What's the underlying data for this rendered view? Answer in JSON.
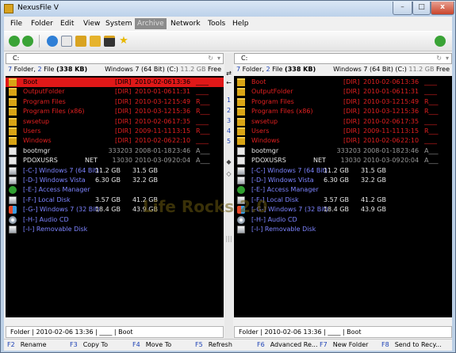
{
  "window": {
    "title": "NexusFile V",
    "minimize": "–",
    "maximize": "□",
    "close": "x"
  },
  "menu": [
    {
      "label": "File",
      "active": false
    },
    {
      "label": "Folder",
      "active": false
    },
    {
      "label": "Edit",
      "active": false
    },
    {
      "label": "View",
      "active": false
    },
    {
      "label": "System",
      "active": false
    },
    {
      "label": "Archive",
      "active": true
    },
    {
      "label": "Network",
      "active": false
    },
    {
      "label": "Tools",
      "active": false
    },
    {
      "label": "Help",
      "active": false
    }
  ],
  "toolbar": {
    "icons": [
      "back-icon",
      "forward-icon",
      "refresh-icon",
      "copy-icon",
      "folder-view-icon",
      "folder-open-icon",
      "terminal-icon",
      "favorite-star-icon",
      "network-sync-icon"
    ],
    "colors": {
      "nav": "#3aa336",
      "accent": "#d9a320"
    }
  },
  "left": {
    "path": "C:",
    "refresh_glyph": "↻",
    "arrow_glyph": "▾",
    "info": {
      "folders": "7",
      "folder_label": "Folder,",
      "files": "2",
      "file_label": "File",
      "size": "(338 KB)",
      "drive": "Windows 7 (64 Bit) (C:)",
      "free": "11.2 GB",
      "free_label": "Free"
    },
    "status": "Folder | 2010-02-06 13:36 | ____ | Boot"
  },
  "right": {
    "path": "C:",
    "refresh_glyph": "↻",
    "arrow_glyph": "▾",
    "info": {
      "folders": "7",
      "folder_label": "Folder,",
      "files": "2",
      "file_label": "File",
      "size": "(338 KB)",
      "drive": "Windows 7 (64 Bit) (C:)",
      "free": "11.2 GB",
      "free_label": "Free"
    },
    "status": "Folder | 2010-02-06 13:36 | ____ | Boot"
  },
  "folders": [
    {
      "name": "Boot",
      "ext": "[DIR]",
      "date": "2010-02-06",
      "time": "13:36",
      "attr": "____"
    },
    {
      "name": "OutputFolder",
      "ext": "[DIR]",
      "date": "2010-01-06",
      "time": "11:31",
      "attr": "____"
    },
    {
      "name": "Program Files",
      "ext": "[DIR]",
      "date": "2010-03-12",
      "time": "15:49",
      "attr": "R___"
    },
    {
      "name": "Program Files (x86)",
      "ext": "[DIR]",
      "date": "2010-03-12",
      "time": "15:36",
      "attr": "R___"
    },
    {
      "name": "swsetup",
      "ext": "[DIR]",
      "date": "2010-02-06",
      "time": "17:35",
      "attr": "____"
    },
    {
      "name": "Users",
      "ext": "[DIR]",
      "date": "2009-11-11",
      "time": "13:15",
      "attr": "R___"
    },
    {
      "name": "Windows",
      "ext": "[DIR]",
      "date": "2010-02-06",
      "time": "22:10",
      "attr": "____"
    }
  ],
  "files": [
    {
      "name": "bootmgr",
      "ext": "",
      "size": "333203",
      "date": "2008-01-18",
      "time": "23:46",
      "attr": "A___"
    },
    {
      "name": "PDOXUSRS",
      "ext": "NET",
      "size": "13030",
      "date": "2010-03-09",
      "time": "20:04",
      "attr": "A___"
    }
  ],
  "drives": [
    {
      "name": "[-C-] Windows 7 (64 Bit)",
      "free": "11.2 GB",
      "total": "31.5 GB",
      "icon": "hard-drive"
    },
    {
      "name": "[-D-] Windows Vista",
      "free": "6.30 GB",
      "total": "32.2 GB",
      "icon": "hard-drive"
    },
    {
      "name": "[-E-] Access Manager",
      "free": "",
      "total": "",
      "icon": "access-manager"
    },
    {
      "name": "[-F-] Local Disk",
      "free": "3.57 GB",
      "total": "41.2 GB",
      "icon": "hard-drive"
    },
    {
      "name": "[-G-] Windows 7 (32 Bit)",
      "free": "18.4 GB",
      "total": "43.9 GB",
      "icon": "windows"
    },
    {
      "name": "[-H-] Audio CD",
      "free": "",
      "total": "",
      "icon": "cd"
    },
    {
      "name": "[-I-] Removable Disk",
      "free": "",
      "total": "",
      "icon": "removable"
    }
  ],
  "middle": {
    "top_arrow": "⇄",
    "left_arrow": "←",
    "numbers": [
      "1",
      "2",
      "3",
      "4",
      "5"
    ],
    "diamond1": "◆",
    "diamond2": "◇",
    "bars": "|||"
  },
  "fkeys": [
    {
      "key": "F2",
      "label": "Rename"
    },
    {
      "key": "F3",
      "label": "Copy To"
    },
    {
      "key": "F4",
      "label": "Move To"
    },
    {
      "key": "F5",
      "label": "Refresh"
    },
    {
      "key": "F6",
      "label": "Advanced Re..."
    },
    {
      "key": "F7",
      "label": "New Folder"
    },
    {
      "key": "F8",
      "label": "Send to Recy..."
    }
  ],
  "watermark": "Life Rocks 2.0"
}
